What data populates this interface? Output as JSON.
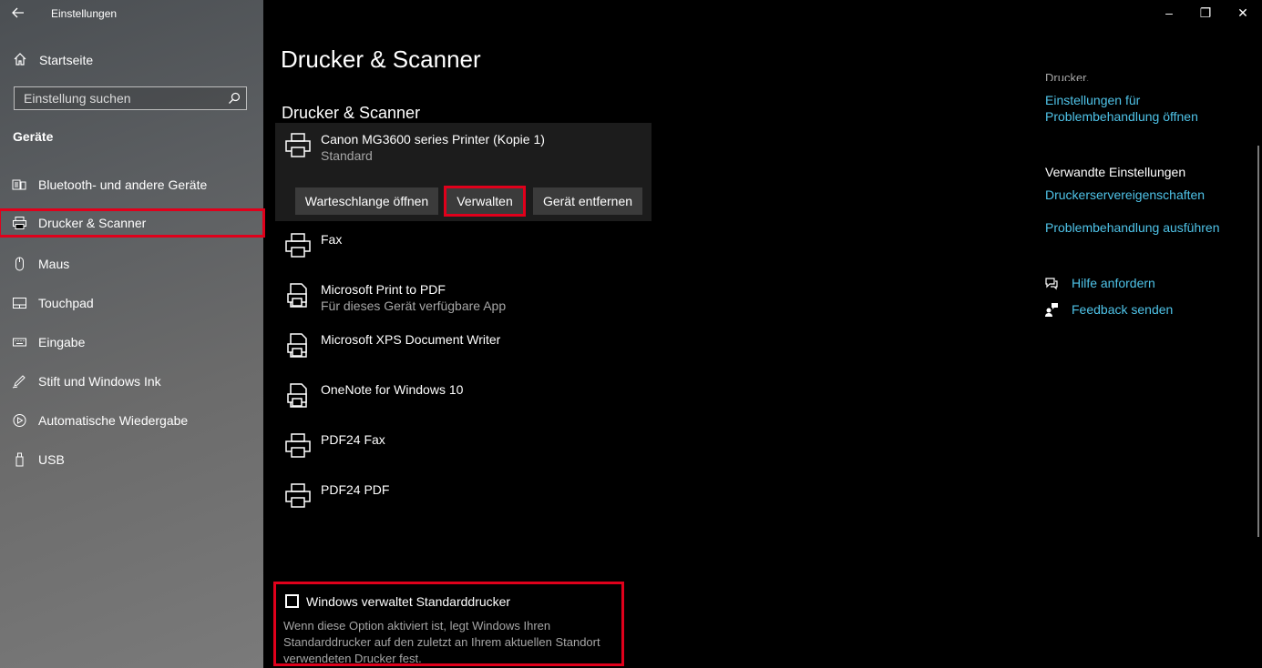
{
  "window": {
    "title": "Einstellungen",
    "back_icon": "back-arrow-icon",
    "controls": {
      "minimize": "–",
      "restore": "❐",
      "close": "✕"
    }
  },
  "sidebar": {
    "home_label": "Startseite",
    "search_placeholder": "Einstellung suchen",
    "section_title": "Geräte",
    "items": [
      {
        "label": "Bluetooth- und andere Geräte",
        "icon": "bluetooth-devices-icon"
      },
      {
        "label": "Drucker & Scanner",
        "icon": "printer-icon",
        "selected": true
      },
      {
        "label": "Maus",
        "icon": "mouse-icon"
      },
      {
        "label": "Touchpad",
        "icon": "touchpad-icon"
      },
      {
        "label": "Eingabe",
        "icon": "keyboard-icon"
      },
      {
        "label": "Stift und Windows Ink",
        "icon": "pen-icon"
      },
      {
        "label": "Automatische Wiedergabe",
        "icon": "autoplay-icon"
      },
      {
        "label": "USB",
        "icon": "usb-icon"
      }
    ]
  },
  "main": {
    "page_title": "Drucker & Scanner",
    "section_title": "Drucker & Scanner",
    "selected_printer": {
      "name": "Canon MG3600 series Printer (Kopie 1)",
      "status": "Standard"
    },
    "buttons": {
      "queue": "Warteschlange öffnen",
      "manage": "Verwalten",
      "remove": "Gerät entfernen"
    },
    "printers": [
      {
        "name": "Fax",
        "status": "",
        "icon": "printer-icon"
      },
      {
        "name": "Microsoft Print to PDF",
        "status": "Für dieses Gerät verfügbare App",
        "icon": "document-printer-icon"
      },
      {
        "name": "Microsoft XPS Document Writer",
        "status": "",
        "icon": "document-printer-icon"
      },
      {
        "name": "OneNote for Windows 10",
        "status": "",
        "icon": "document-printer-icon"
      },
      {
        "name": "PDF24 Fax",
        "status": "",
        "icon": "printer-icon"
      },
      {
        "name": "PDF24 PDF",
        "status": "",
        "icon": "printer-icon"
      }
    ],
    "default_printer_option": {
      "label": "Windows verwaltet Standarddrucker",
      "checked": false,
      "description": "Wenn diese Option aktiviert ist, legt Windows Ihren Standarddrucker auf den zuletzt an Ihrem aktuellen Standort verwendeten Drucker fest."
    }
  },
  "right": {
    "cut_text": "Drucker.",
    "troubleshoot_settings_link": "Einstellungen für Problembehandlung öffnen",
    "related_title": "Verwandte Einstellungen",
    "print_server_link": "Druckerservereigenschaften",
    "run_troubleshooter_link": "Problembehandlung ausführen",
    "help_link": "Hilfe anfordern",
    "feedback_link": "Feedback senden"
  },
  "colors": {
    "accent_link": "#4fc3e8",
    "highlight_border": "#e0001b",
    "card_bg": "#1c1c1c",
    "button_bg": "#3b3b3b"
  }
}
